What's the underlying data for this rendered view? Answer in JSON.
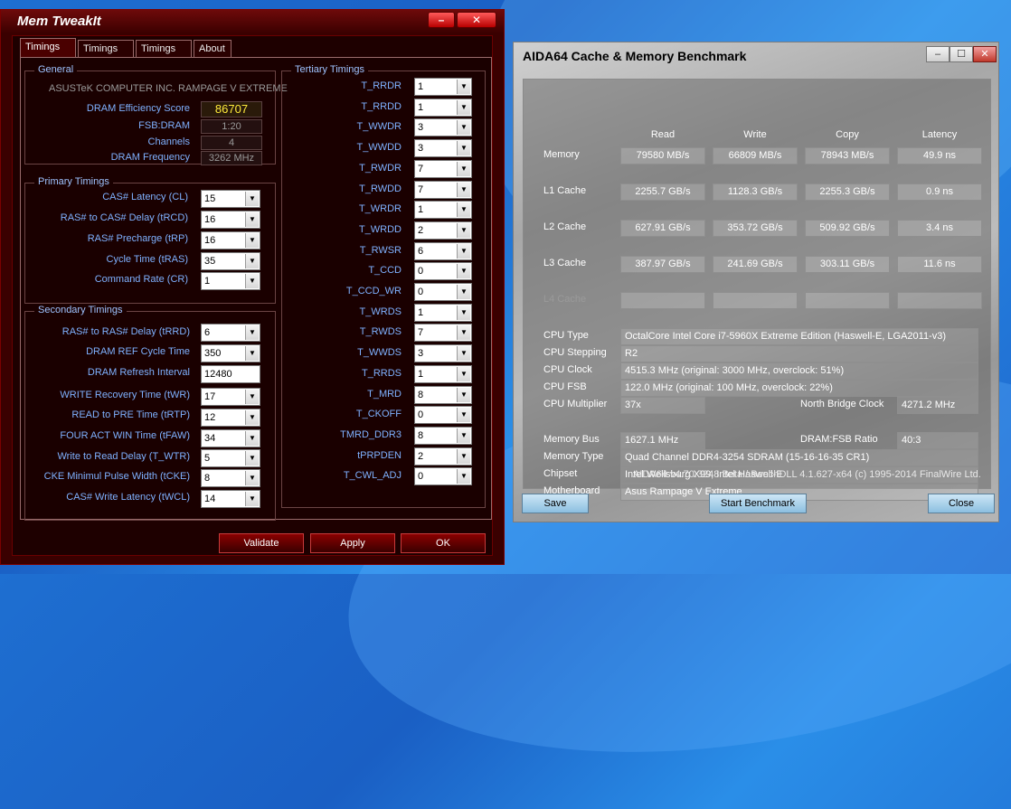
{
  "memtweakit": {
    "title": "Mem TweakIt",
    "tabs": [
      "Timings #1",
      "Timings #2",
      "Timings #3",
      "About"
    ],
    "general": {
      "title": "General",
      "board": "ASUSTeK COMPUTER INC. RAMPAGE V EXTREME",
      "rows": [
        {
          "label": "DRAM Efficiency Score",
          "value": "86707"
        },
        {
          "label": "FSB:DRAM",
          "value": "1:20"
        },
        {
          "label": "Channels",
          "value": "4"
        },
        {
          "label": "DRAM Frequency",
          "value": "3262 MHz"
        }
      ]
    },
    "primary": {
      "title": "Primary Timings",
      "rows": [
        {
          "label": "CAS# Latency (CL)",
          "value": "15"
        },
        {
          "label": "RAS# to CAS# Delay (tRCD)",
          "value": "16"
        },
        {
          "label": "RAS# Precharge (tRP)",
          "value": "16"
        },
        {
          "label": "Cycle Time (tRAS)",
          "value": "35"
        },
        {
          "label": "Command Rate (CR)",
          "value": "1"
        }
      ]
    },
    "secondary": {
      "title": "Secondary Timings",
      "rows": [
        {
          "label": "RAS# to RAS# Delay (tRRD)",
          "value": "6"
        },
        {
          "label": "DRAM REF Cycle Time",
          "value": "350"
        },
        {
          "label": "DRAM Refresh Interval",
          "value": "12480"
        },
        {
          "label": "WRITE Recovery Time (tWR)",
          "value": "17"
        },
        {
          "label": "READ to PRE Time (tRTP)",
          "value": "12"
        },
        {
          "label": "FOUR ACT WIN Time (tFAW)",
          "value": "34"
        },
        {
          "label": "Write to Read Delay (T_WTR)",
          "value": "5"
        },
        {
          "label": "CKE Minimul Pulse Width (tCKE)",
          "value": "8"
        },
        {
          "label": "CAS# Write Latency (tWCL)",
          "value": "14"
        }
      ]
    },
    "tertiary": {
      "title": "Tertiary Timings",
      "rows": [
        {
          "label": "T_RRDR",
          "value": "1"
        },
        {
          "label": "T_RRDD",
          "value": "1"
        },
        {
          "label": "T_WWDR",
          "value": "3"
        },
        {
          "label": "T_WWDD",
          "value": "3"
        },
        {
          "label": "T_RWDR",
          "value": "7"
        },
        {
          "label": "T_RWDD",
          "value": "7"
        },
        {
          "label": "T_WRDR",
          "value": "1"
        },
        {
          "label": "T_WRDD",
          "value": "2"
        },
        {
          "label": "T_RWSR",
          "value": "6"
        },
        {
          "label": "T_CCD",
          "value": "0"
        },
        {
          "label": "T_CCD_WR",
          "value": "0"
        },
        {
          "label": "T_WRDS",
          "value": "1"
        },
        {
          "label": "T_RWDS",
          "value": "7"
        },
        {
          "label": "T_WWDS",
          "value": "3"
        },
        {
          "label": "T_RRDS",
          "value": "1"
        },
        {
          "label": "T_MRD",
          "value": "8"
        },
        {
          "label": "T_CKOFF",
          "value": "0"
        },
        {
          "label": "TMRD_DDR3",
          "value": "8"
        },
        {
          "label": "tPRPDEN",
          "value": "2"
        },
        {
          "label": "T_CWL_ADJ",
          "value": "0"
        }
      ]
    },
    "buttons": {
      "validate": "Validate",
      "apply": "Apply",
      "ok": "OK"
    }
  },
  "aida": {
    "title": "AIDA64 Cache & Memory Benchmark",
    "columns": [
      "Read",
      "Write",
      "Copy",
      "Latency"
    ],
    "bench_rows": [
      {
        "label": "Memory",
        "values": [
          "79580 MB/s",
          "66809 MB/s",
          "78943 MB/s",
          "49.9 ns"
        ]
      },
      {
        "label": "L1 Cache",
        "values": [
          "2255.7 GB/s",
          "1128.3 GB/s",
          "2255.3 GB/s",
          "0.9 ns"
        ]
      },
      {
        "label": "L2 Cache",
        "values": [
          "627.91 GB/s",
          "353.72 GB/s",
          "509.92 GB/s",
          "3.4 ns"
        ]
      },
      {
        "label": "L3 Cache",
        "values": [
          "387.97 GB/s",
          "241.69 GB/s",
          "303.11 GB/s",
          "11.6 ns"
        ]
      },
      {
        "label": "L4 Cache",
        "values": [
          "",
          "",
          "",
          ""
        ]
      }
    ],
    "cpu": {
      "type_label": "CPU Type",
      "type": "OctalCore Intel Core i7-5960X Extreme Edition  (Haswell-E, LGA2011-v3)",
      "stepping_label": "CPU Stepping",
      "stepping": "R2",
      "clock_label": "CPU Clock",
      "clock": "4515.3 MHz  (original: 3000 MHz, overclock: 51%)",
      "fsb_label": "CPU FSB",
      "fsb": "122.0 MHz  (original: 100 MHz, overclock: 22%)",
      "mult_label": "CPU Multiplier",
      "mult": "37x",
      "nb_label": "North Bridge Clock",
      "nb": "4271.2 MHz"
    },
    "mem": {
      "bus_label": "Memory Bus",
      "bus": "1627.1 MHz",
      "ratio_label": "DRAM:FSB Ratio",
      "ratio": "40:3",
      "type_label": "Memory Type",
      "type": "Quad Channel DDR4-3254 SDRAM  (15-16-16-35 CR1)",
      "chipset_label": "Chipset",
      "chipset": "Intel Wellsburg X99, Intel Haswell-E",
      "mobo_label": "Motherboard",
      "mobo": "Asus Rampage V Extreme"
    },
    "footer": "AIDA64 v4.70.3248 Beta / BenchDLL 4.1.627-x64  (c) 1995-2014 FinalWire Ltd.",
    "buttons": {
      "save": "Save",
      "start": "Start Benchmark",
      "close": "Close"
    }
  }
}
